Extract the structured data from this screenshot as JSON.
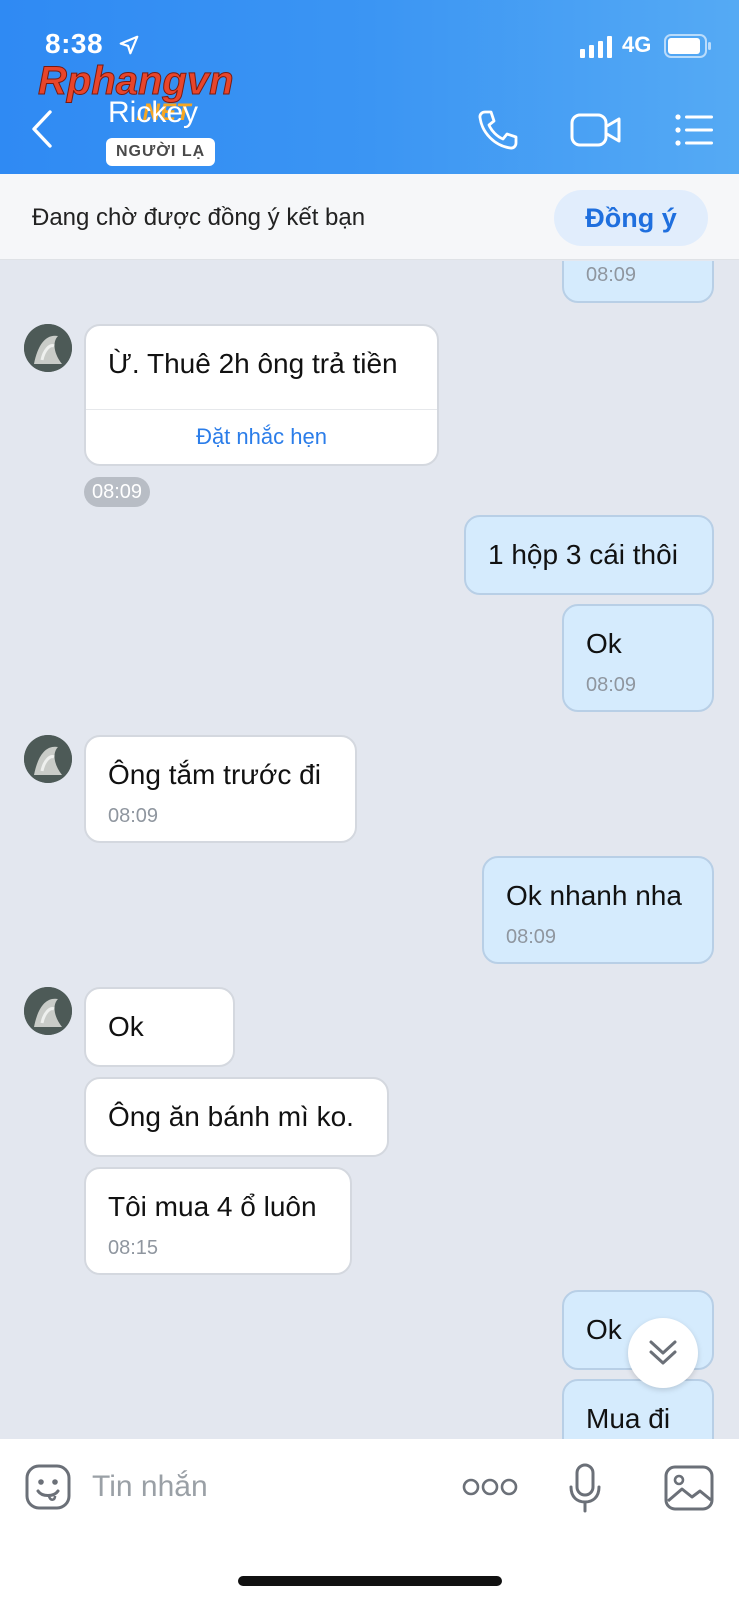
{
  "status_bar": {
    "time": "8:38",
    "network": "4G"
  },
  "watermark": {
    "text_main": "Rphangvn",
    "text_sub": ".NET"
  },
  "header": {
    "contact_name": "Rickey",
    "badge": "NGƯỜI LẠ"
  },
  "friend_request": {
    "text": "Đang chờ được đồng ý kết bạn",
    "accept_label": "Đồng ý"
  },
  "messages": [
    {
      "dir": "out",
      "text": "",
      "time": "08:09"
    },
    {
      "dir": "in",
      "text": "Ừ. Thuê 2h ông trả tiền",
      "action": "Đặt nhắc hẹn",
      "time": "08:09"
    },
    {
      "dir": "out",
      "text": "1 hộp 3 cái thôi"
    },
    {
      "dir": "out",
      "text": "Ok",
      "time": "08:09"
    },
    {
      "dir": "in",
      "text": "Ông tắm trước đi",
      "time": "08:09"
    },
    {
      "dir": "out",
      "text": "Ok nhanh nha",
      "time": "08:09"
    },
    {
      "dir": "in",
      "text": "Ok"
    },
    {
      "dir": "in",
      "text": "Ông ăn bánh mì ko."
    },
    {
      "dir": "in",
      "text": "Tôi mua 4 ổ luôn",
      "time": "08:15"
    },
    {
      "dir": "out",
      "text": "Ok"
    },
    {
      "dir": "out",
      "text": "Mua đi"
    }
  ],
  "composer": {
    "placeholder": "Tin nhắn"
  },
  "colors": {
    "header_blue": "#3b95f3",
    "accent_blue": "#2b7de9",
    "out_bubble": "#d5ebfd"
  }
}
